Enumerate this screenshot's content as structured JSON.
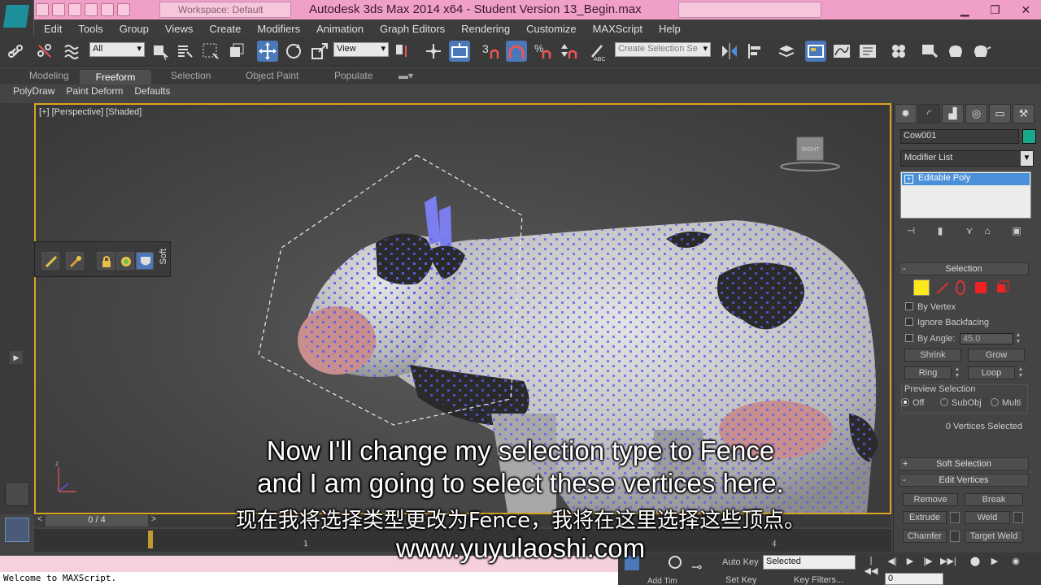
{
  "title_bar": {
    "workspace": "Workspace: Default",
    "window_title": "Autodesk 3ds Max  2014 x64  - Student Version    13_Begin.max",
    "window_controls": [
      "▁",
      "❐",
      "✕"
    ]
  },
  "menu": [
    "Edit",
    "Tools",
    "Group",
    "Views",
    "Create",
    "Modifiers",
    "Animation",
    "Graph Editors",
    "Rendering",
    "Customize",
    "MAXScript",
    "Help"
  ],
  "toolbar": {
    "selection_filter": "All",
    "reference_coord": "View",
    "named_selection_placeholder": "Create Selection Se",
    "snaps_label": "3"
  },
  "ribbon": {
    "tabs": [
      "Modeling",
      "Freeform",
      "Selection",
      "Object Paint",
      "Populate"
    ],
    "active_tab": "Freeform",
    "subtabs": [
      "PolyDraw",
      "Paint Deform",
      "Defaults"
    ]
  },
  "viewport": {
    "label": "[+] [Perspective] [Shaded]",
    "viewcube_face": "RIGHT",
    "soft_label": "Soft"
  },
  "timeline": {
    "frame_display": "0 / 4",
    "prev": "<",
    "next": ">",
    "tick_labels": [
      "1",
      "4"
    ]
  },
  "status": {
    "maxscript_text": "Welcome to MAXScript.",
    "auto_key": "Auto Key",
    "set_key": "Set Key",
    "selected_dropdown": "Selected",
    "key_filters": "Key Filters...",
    "add_time_tag": "Add Tim",
    "frame_value": "0"
  },
  "command_panel": {
    "object_name": "Cow001",
    "object_color": "#1aa88c",
    "modifier_list": "Modifier List",
    "stack_item": "Editable Poly",
    "selection_rollout": {
      "title": "Selection",
      "by_vertex": "By Vertex",
      "ignore_backfacing": "Ignore Backfacing",
      "by_angle": "By Angle:",
      "angle_value": "45.0",
      "shrink": "Shrink",
      "grow": "Grow",
      "ring": "Ring",
      "loop": "Loop",
      "preview_selection": "Preview Selection",
      "preview_options": [
        "Off",
        "SubObj",
        "Multi"
      ],
      "preview_selected": "Off",
      "status": "0 Vertices Selected"
    },
    "soft_selection_title": "Soft Selection",
    "edit_vertices": {
      "title": "Edit Vertices",
      "remove": "Remove",
      "break": "Break",
      "extrude": "Extrude",
      "weld": "Weld",
      "chamfer": "Chamfer",
      "target_weld": "Target Weld"
    }
  },
  "subtitles": {
    "line1": "Now I'll change my selection type to Fence",
    "line2": "and I am going to select these vertices here.",
    "line3": "现在我将选择类型更改为Fence，我将在这里选择这些顶点。",
    "line4": "www.yuyulaoshi.com"
  },
  "colors": {
    "title_bar": "#f0a0c8",
    "viewport_border": "#d9a520",
    "vertex_color": "#5a5cf0",
    "selection_active": "#4a90d9"
  }
}
